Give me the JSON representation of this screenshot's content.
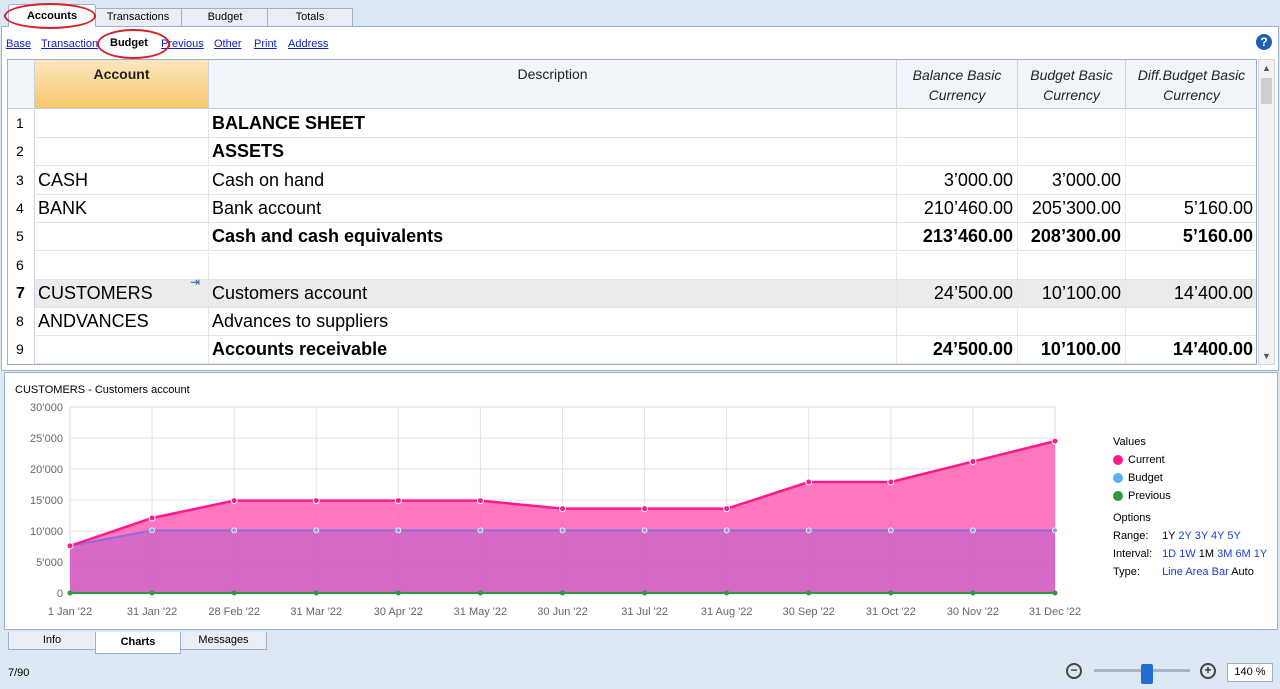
{
  "top_tabs": [
    "Accounts",
    "Transactions",
    "Budget",
    "Totals"
  ],
  "sub_nav": [
    "Base",
    "Transaction",
    "Budget",
    "Previous",
    "Other",
    "Print",
    "Address"
  ],
  "help_glyph": "?",
  "columns": {
    "account": "Account",
    "description": "Description",
    "balance_1": "Balance Basic",
    "balance_2": "Currency",
    "budget_1": "Budget Basic",
    "budget_2": "Currency",
    "diff_1": "Diff.Budget Basic",
    "diff_2": "Currency"
  },
  "rows": [
    {
      "n": "1",
      "account": "",
      "description": "BALANCE SHEET",
      "balance": "",
      "budget": "",
      "diff": "",
      "bold": true
    },
    {
      "n": "2",
      "account": "",
      "description": "ASSETS",
      "balance": "",
      "budget": "",
      "diff": "",
      "bold": true
    },
    {
      "n": "3",
      "account": "CASH",
      "description": "Cash on hand",
      "balance": "3’000.00",
      "budget": "3’000.00",
      "diff": "",
      "bold": false
    },
    {
      "n": "4",
      "account": "BANK",
      "description": "Bank account",
      "balance": "210’460.00",
      "budget": "205’300.00",
      "diff": "5’160.00",
      "bold": false
    },
    {
      "n": "5",
      "account": "",
      "description": "Cash and cash equivalents",
      "balance": "213’460.00",
      "budget": "208’300.00",
      "diff": "5’160.00",
      "bold": true
    },
    {
      "n": "6",
      "account": "",
      "description": "",
      "balance": "",
      "budget": "",
      "diff": "",
      "bold": false
    },
    {
      "n": "7",
      "account": "CUSTOMERS",
      "description": "Customers account",
      "balance": "24’500.00",
      "budget": "10’100.00",
      "diff": "14’400.00",
      "bold": false,
      "selected": true
    },
    {
      "n": "8",
      "account": "ANDVANCES",
      "description": "Advances to suppliers",
      "balance": "",
      "budget": "",
      "diff": "",
      "bold": false
    },
    {
      "n": "9",
      "account": "",
      "description": "Accounts receivable",
      "balance": "24’500.00",
      "budget": "10’100.00",
      "diff": "14’400.00",
      "bold": true
    }
  ],
  "chart_title": "CUSTOMERS - Customers account",
  "chart_data": {
    "type": "area",
    "title": "CUSTOMERS - Customers account",
    "x": [
      "1 Jan '22",
      "31 Jan '22",
      "28 Feb '22",
      "31 Mar '22",
      "30 Apr '22",
      "31 May '22",
      "30 Jun '22",
      "31 Jul '22",
      "31 Aug '22",
      "30 Sep '22",
      "31 Oct '22",
      "30 Nov '22",
      "31 Dec '22"
    ],
    "y_ticks": [
      "30’000",
      "25’000",
      "20’000",
      "15’000",
      "10’000",
      "5’000",
      "0"
    ],
    "ylim": [
      0,
      30000
    ],
    "grid": true,
    "legend_position": "right",
    "series": [
      {
        "name": "Current",
        "color": "#ff1a8c",
        "values": [
          7600,
          12100,
          14900,
          14900,
          14900,
          14900,
          13600,
          13600,
          13600,
          17900,
          17900,
          21200,
          24500
        ]
      },
      {
        "name": "Budget",
        "color": "#5ab0f0",
        "values": [
          7600,
          10100,
          10100,
          10100,
          10100,
          10100,
          10100,
          10100,
          10100,
          10100,
          10100,
          10100,
          10100
        ]
      },
      {
        "name": "Previous",
        "color": "#2a9a3a",
        "values": [
          0,
          0,
          0,
          0,
          0,
          0,
          0,
          0,
          0,
          0,
          0,
          0,
          0
        ]
      }
    ]
  },
  "legend": {
    "values_title": "Values",
    "options_title": "Options",
    "range_label": "Range:",
    "range_options": [
      "1Y",
      "2Y",
      "3Y",
      "4Y",
      "5Y"
    ],
    "interval_label": "Interval:",
    "interval_options": [
      "1D",
      "1W",
      "1M",
      "3M",
      "6M",
      "1Y"
    ],
    "type_label": "Type:",
    "type_options": [
      "Line",
      "Area",
      "Bar",
      "Auto"
    ]
  },
  "bottom_tabs": [
    "Info",
    "Charts",
    "Messages"
  ],
  "status": {
    "row_count": "7/90",
    "zoom": "140 %",
    "zoom_level_percent": 140
  }
}
